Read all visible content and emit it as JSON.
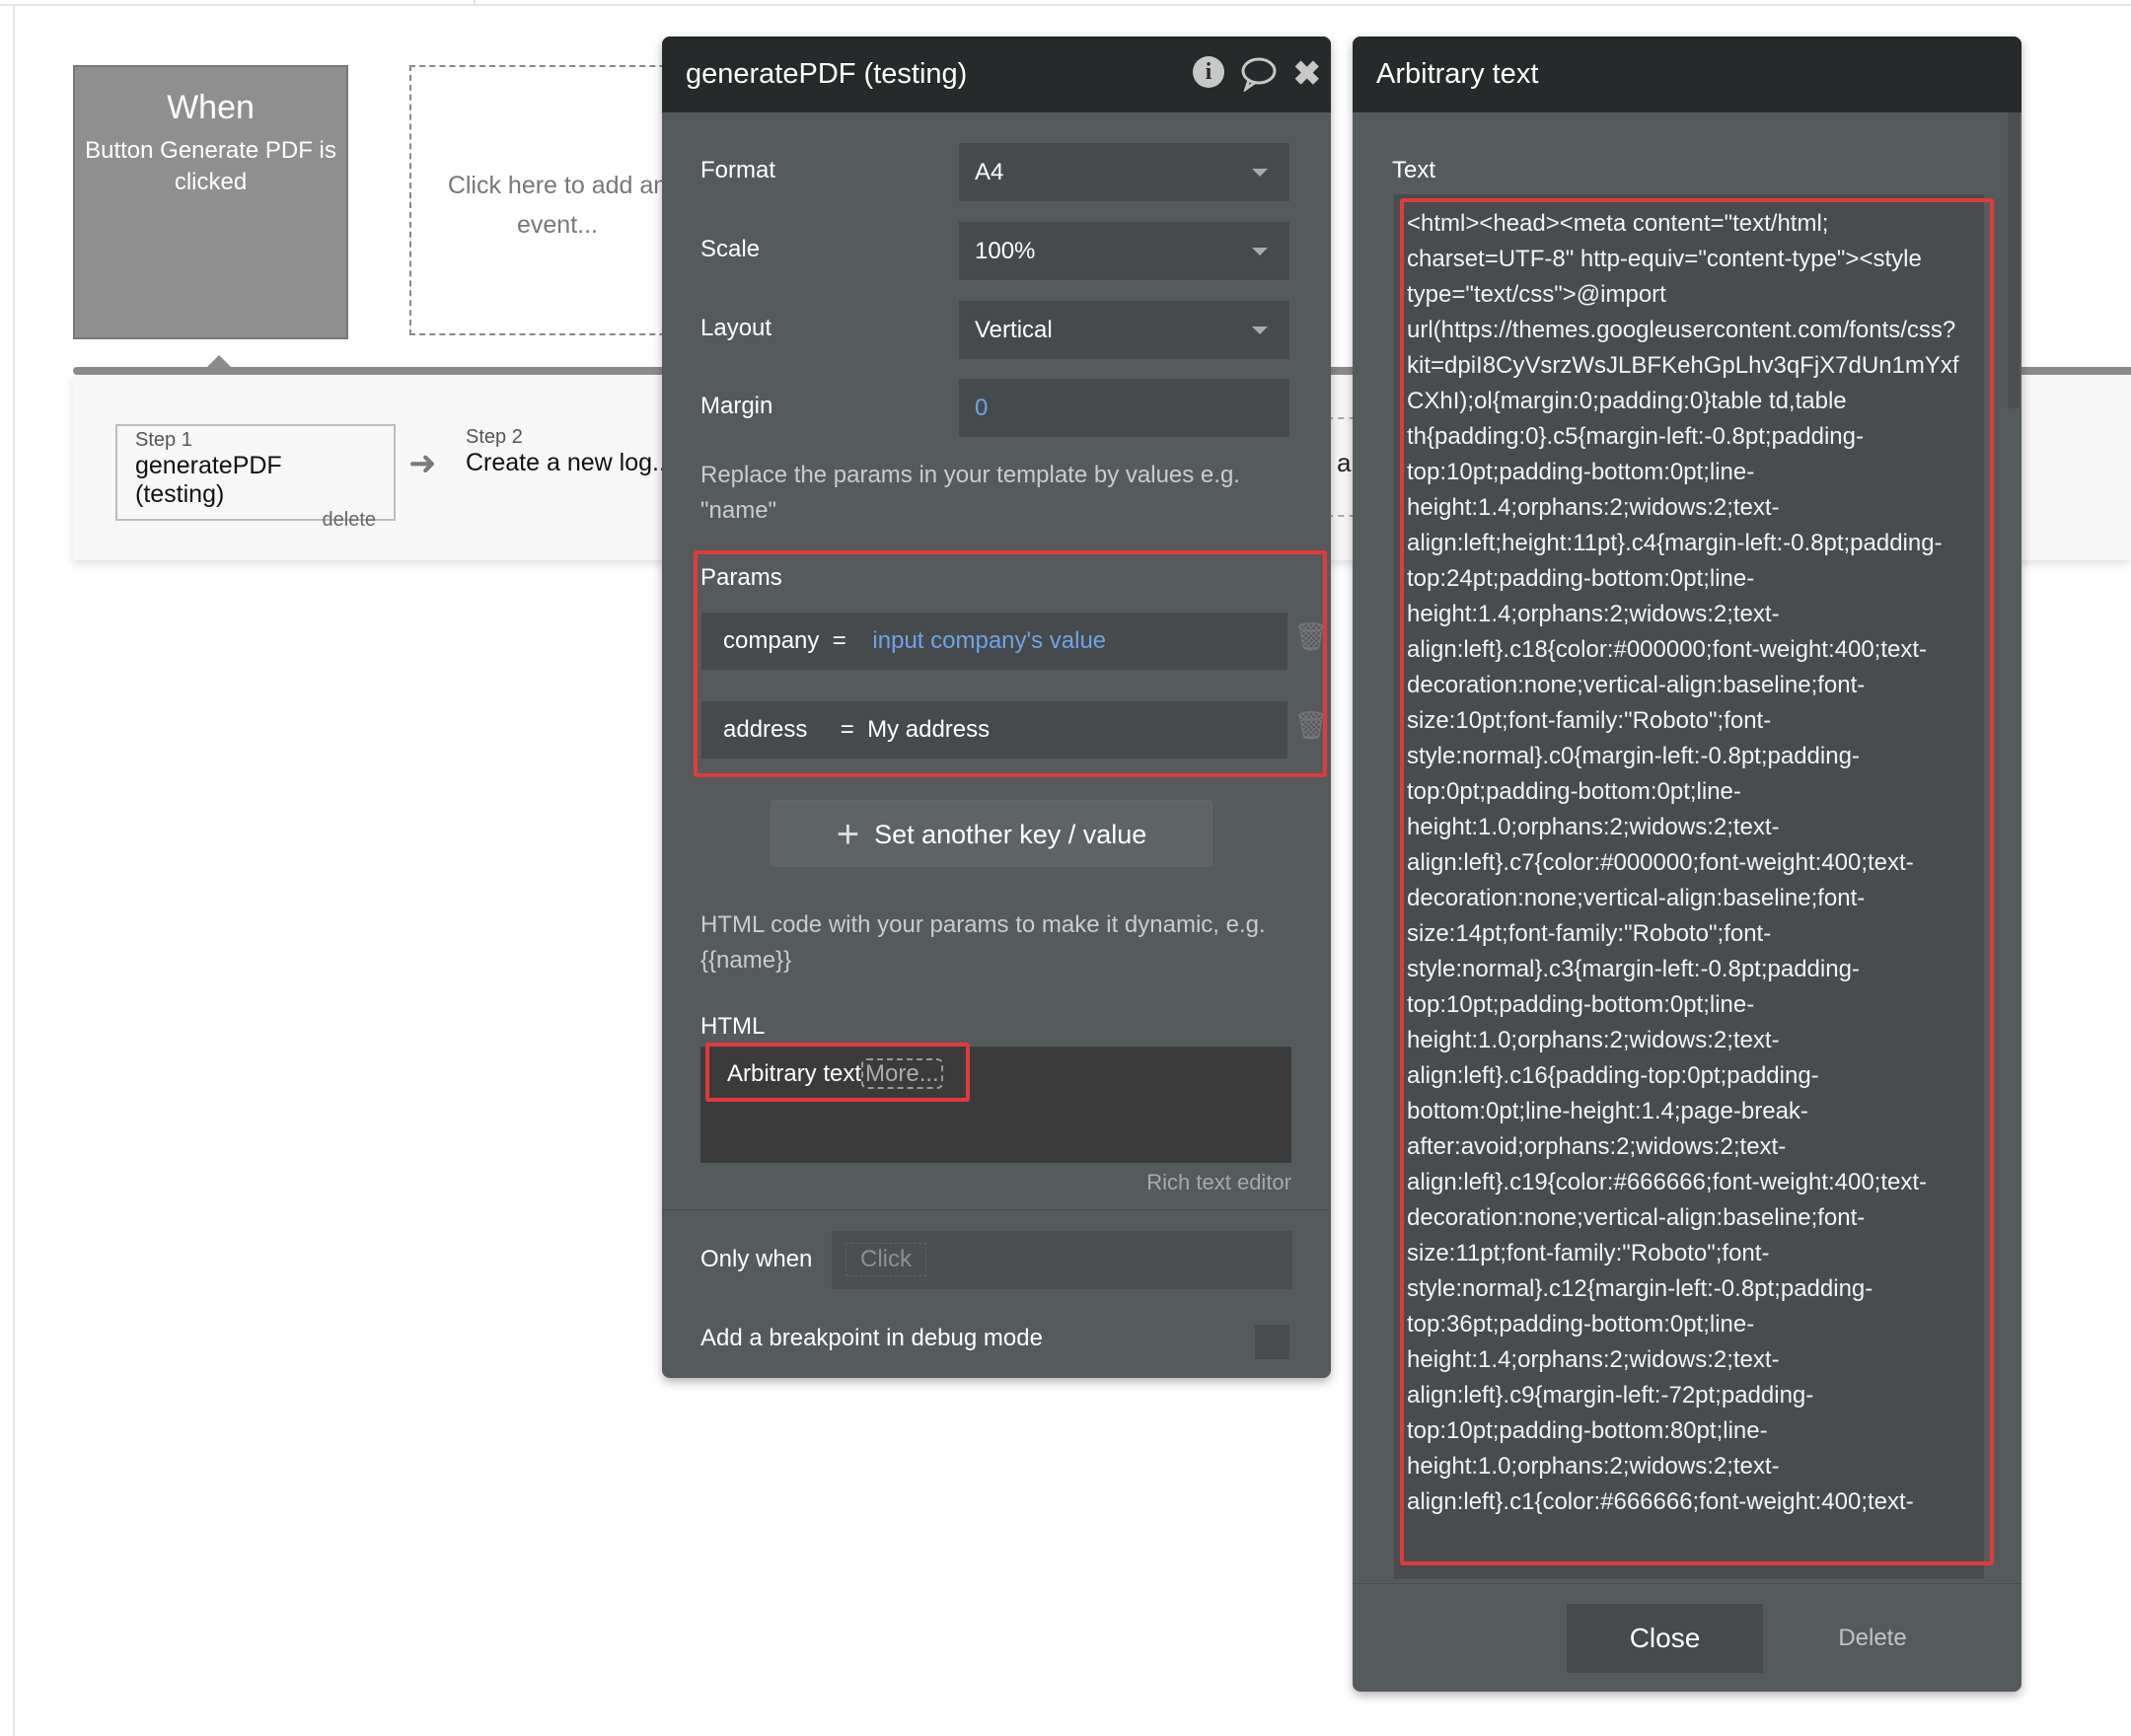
{
  "workflow": {
    "event": {
      "title": "When",
      "subtitle": "Button Generate PDF is clicked"
    },
    "add_event": "Click here to add an event...",
    "steps": [
      {
        "label": "Step 1",
        "name": "generatePDF (testing)",
        "delete": "delete"
      },
      {
        "label": "Step 2",
        "name": "Create a new log..."
      },
      {
        "name_fragment": "a"
      }
    ]
  },
  "action_panel": {
    "title": "generatePDF (testing)",
    "icons": [
      "info-icon",
      "comment-icon",
      "close-icon"
    ],
    "fields": {
      "format": {
        "label": "Format",
        "value": "A4"
      },
      "scale": {
        "label": "Scale",
        "value": "100%"
      },
      "layout": {
        "label": "Layout",
        "value": "Vertical"
      },
      "margin": {
        "label": "Margin",
        "value": "0"
      }
    },
    "params_hint": "Replace the params in your template by values e.g. \"name\"",
    "params_label": "Params",
    "params": [
      {
        "key": "company",
        "eq": "=",
        "value": "input company's value",
        "dynamic": true
      },
      {
        "key": "address",
        "eq": "=",
        "value": "My address",
        "dynamic": false
      }
    ],
    "add_param_label": "Set another key / value",
    "html_hint": "HTML code with your params to make it dynamic, e.g. {{name}}",
    "html_label": "HTML",
    "html_value": "Arbitrary text",
    "html_more": "More...",
    "rich_text_link": "Rich text editor",
    "only_when_label": "Only when",
    "only_when_placeholder": "Click",
    "breakpoint_label": "Add a breakpoint in debug mode",
    "breakpoint_checked": false
  },
  "text_panel": {
    "title": "Arbitrary text",
    "text_label": "Text",
    "text_value": "<html><head><meta content=\"text/html; charset=UTF-8\" http-equiv=\"content-type\"><style type=\"text/css\">@import url(https://themes.googleusercontent.com/fonts/css?kit=dpiI8CyVsrzWsJLBFKehGpLhv3qFjX7dUn1mYxfCXhI);ol{margin:0;padding:0}table td,table th{padding:0}.c5{margin-left:-0.8pt;padding-top:10pt;padding-bottom:0pt;line-height:1.4;orphans:2;widows:2;text-align:left;height:11pt}.c4{margin-left:-0.8pt;padding-top:24pt;padding-bottom:0pt;line-height:1.4;orphans:2;widows:2;text-align:left}.c18{color:#000000;font-weight:400;text-decoration:none;vertical-align:baseline;font-size:10pt;font-family:\"Roboto\";font-style:normal}.c0{margin-left:-0.8pt;padding-top:0pt;padding-bottom:0pt;line-height:1.0;orphans:2;widows:2;text-align:left}.c7{color:#000000;font-weight:400;text-decoration:none;vertical-align:baseline;font-size:14pt;font-family:\"Roboto\";font-style:normal}.c3{margin-left:-0.8pt;padding-top:10pt;padding-bottom:0pt;line-height:1.0;orphans:2;widows:2;text-align:left}.c16{padding-top:0pt;padding-bottom:0pt;line-height:1.4;page-break-after:avoid;orphans:2;widows:2;text-align:left}.c19{color:#666666;font-weight:400;text-decoration:none;vertical-align:baseline;font-size:11pt;font-family:\"Roboto\";font-style:normal}.c12{margin-left:-0.8pt;padding-top:36pt;padding-bottom:0pt;line-height:1.4;orphans:2;widows:2;text-align:left}.c9{margin-left:-72pt;padding-top:10pt;padding-bottom:80pt;line-height:1.0;orphans:2;widows:2;text-align:left}.c1{color:#666666;font-weight:400;text-",
    "close_label": "Close",
    "delete_label": "Delete"
  },
  "colors": {
    "panel_header": "#262a2b",
    "panel_body": "#555a5d",
    "highlight": "#e03b3b",
    "dynamic_value": "#6aa5e8"
  }
}
